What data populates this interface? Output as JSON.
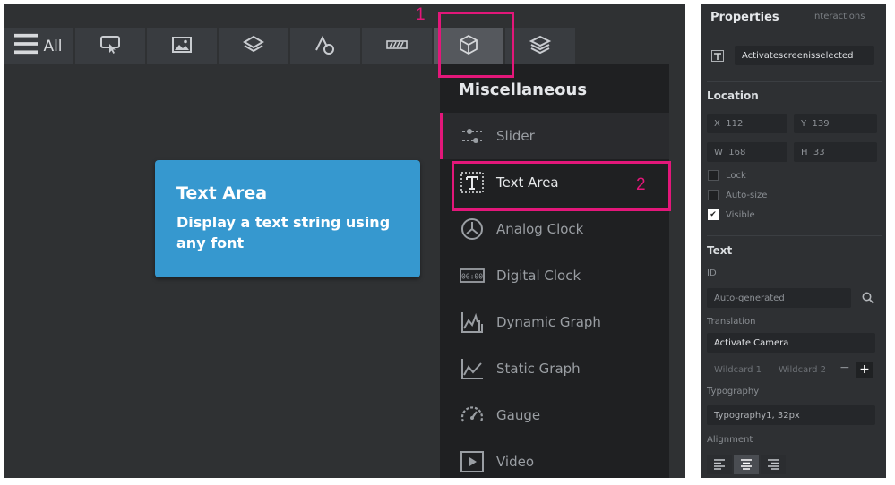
{
  "toolbar": {
    "all_label": "All",
    "items": [
      {
        "icon": "touch-screen-icon"
      },
      {
        "icon": "image-icon"
      },
      {
        "icon": "layers-icon"
      },
      {
        "icon": "shapes-icon"
      },
      {
        "icon": "progress-bar-icon"
      },
      {
        "icon": "cube-icon",
        "active": true
      },
      {
        "icon": "stack-icon"
      }
    ]
  },
  "callouts": {
    "one": "1",
    "two": "2"
  },
  "colors": {
    "highlight": "#e3177a",
    "tooltip": "#3698cf",
    "panel": "#2e3033",
    "canvas": "#2f3133"
  },
  "tooltip": {
    "title": "Text Area",
    "description": "Display a text string using any font"
  },
  "menu": {
    "heading": "Miscellaneous",
    "items": [
      {
        "label": "Slider",
        "icon": "slider-icon"
      },
      {
        "label": "Text Area",
        "icon": "text-area-icon"
      },
      {
        "label": "Analog Clock",
        "icon": "analog-clock-icon"
      },
      {
        "label": "Digital Clock",
        "icon": "digital-clock-icon"
      },
      {
        "label": "Dynamic Graph",
        "icon": "dynamic-graph-icon"
      },
      {
        "label": "Static Graph",
        "icon": "static-graph-icon"
      },
      {
        "label": "Gauge",
        "icon": "gauge-icon"
      },
      {
        "label": "Video",
        "icon": "video-icon"
      }
    ]
  },
  "properties": {
    "title": "Properties",
    "interactions_tab": "Interactions",
    "widget_name": "Activatescreenisselected",
    "location": {
      "heading": "Location",
      "x_label": "X",
      "x": "112",
      "y_label": "Y",
      "y": "139",
      "w_label": "W",
      "w": "168",
      "h_label": "H",
      "h": "33",
      "lock": "Lock",
      "autosize": "Auto-size",
      "visible": "Visible"
    },
    "text": {
      "heading": "Text",
      "id_label": "ID",
      "id_value": "Auto-generated",
      "translation_label": "Translation",
      "translation_value": "Activate Camera",
      "wildcard1": "Wildcard 1",
      "wildcard2": "Wildcard 2",
      "minus": "−",
      "plus": "+",
      "typography_label": "Typography",
      "typography_value": "Typography1, 32px",
      "alignment_label": "Alignment"
    }
  }
}
